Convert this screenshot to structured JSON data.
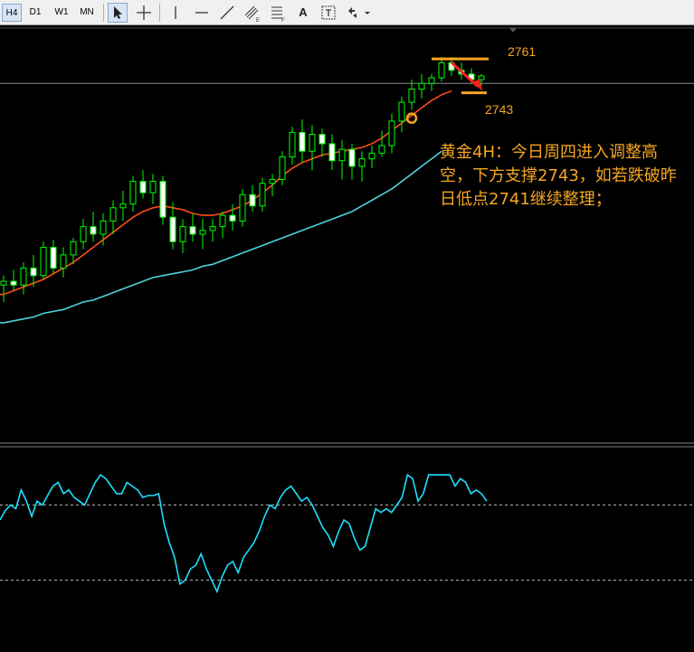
{
  "toolbar": {
    "timeframes": [
      "H4",
      "D1",
      "W1",
      "MN"
    ],
    "active_timeframe": "H4",
    "text_tool_label": "A",
    "tools": [
      "cursor-icon",
      "crosshair-icon",
      "vertical-line-icon",
      "horizontal-line-icon",
      "trendline-icon",
      "equidistant-channel-icon",
      "fibonacci-icon",
      "text-icon",
      "text-label-icon",
      "arrows-icon",
      "dropdown-caret-icon"
    ]
  },
  "annotation": {
    "text": "黄金4H：今日周四进入调整高空，下方支撑2743，如若跌破昨日低点2741继续整理；",
    "upper_price_label": "2761",
    "lower_price_label": "2743"
  },
  "colors": {
    "background": "#000000",
    "bull_candle": "#00ff00",
    "bear_candle": "#ffffff",
    "ma_fast": "#ff4d1a",
    "ma_slow": "#4fd1d9",
    "oscillator": "#1ee0ff",
    "annotation": "#f5a623",
    "arrow": "#ff2020"
  },
  "chart_data": [
    {
      "type": "candlestick",
      "title": "",
      "note": "Gold H4 candles with two moving averages; values approximated from price labels 2761 and 2743",
      "ylim": [
        2560,
        2775
      ],
      "grid": false,
      "reference_level": 2748,
      "candles": [
        {
          "o": 2641,
          "h": 2646,
          "l": 2632,
          "c": 2643
        },
        {
          "o": 2643,
          "h": 2649,
          "l": 2638,
          "c": 2641
        },
        {
          "o": 2641,
          "h": 2653,
          "l": 2636,
          "c": 2650
        },
        {
          "o": 2650,
          "h": 2657,
          "l": 2640,
          "c": 2646
        },
        {
          "o": 2646,
          "h": 2664,
          "l": 2644,
          "c": 2661
        },
        {
          "o": 2661,
          "h": 2665,
          "l": 2647,
          "c": 2650
        },
        {
          "o": 2650,
          "h": 2661,
          "l": 2645,
          "c": 2657
        },
        {
          "o": 2657,
          "h": 2666,
          "l": 2652,
          "c": 2664
        },
        {
          "o": 2664,
          "h": 2676,
          "l": 2660,
          "c": 2672
        },
        {
          "o": 2672,
          "h": 2680,
          "l": 2664,
          "c": 2668
        },
        {
          "o": 2668,
          "h": 2679,
          "l": 2662,
          "c": 2675
        },
        {
          "o": 2675,
          "h": 2686,
          "l": 2668,
          "c": 2682
        },
        {
          "o": 2682,
          "h": 2691,
          "l": 2675,
          "c": 2684
        },
        {
          "o": 2684,
          "h": 2699,
          "l": 2680,
          "c": 2696
        },
        {
          "o": 2696,
          "h": 2702,
          "l": 2687,
          "c": 2690
        },
        {
          "o": 2690,
          "h": 2700,
          "l": 2684,
          "c": 2696
        },
        {
          "o": 2696,
          "h": 2699,
          "l": 2673,
          "c": 2677
        },
        {
          "o": 2677,
          "h": 2685,
          "l": 2660,
          "c": 2664
        },
        {
          "o": 2664,
          "h": 2676,
          "l": 2658,
          "c": 2672
        },
        {
          "o": 2672,
          "h": 2679,
          "l": 2664,
          "c": 2668
        },
        {
          "o": 2668,
          "h": 2676,
          "l": 2660,
          "c": 2670
        },
        {
          "o": 2670,
          "h": 2676,
          "l": 2664,
          "c": 2672
        },
        {
          "o": 2672,
          "h": 2680,
          "l": 2666,
          "c": 2678
        },
        {
          "o": 2678,
          "h": 2684,
          "l": 2670,
          "c": 2675
        },
        {
          "o": 2675,
          "h": 2692,
          "l": 2672,
          "c": 2689
        },
        {
          "o": 2689,
          "h": 2694,
          "l": 2680,
          "c": 2683
        },
        {
          "o": 2683,
          "h": 2698,
          "l": 2680,
          "c": 2695
        },
        {
          "o": 2695,
          "h": 2700,
          "l": 2688,
          "c": 2697
        },
        {
          "o": 2697,
          "h": 2712,
          "l": 2694,
          "c": 2709
        },
        {
          "o": 2709,
          "h": 2725,
          "l": 2705,
          "c": 2722
        },
        {
          "o": 2722,
          "h": 2729,
          "l": 2706,
          "c": 2712
        },
        {
          "o": 2712,
          "h": 2726,
          "l": 2702,
          "c": 2721
        },
        {
          "o": 2721,
          "h": 2724,
          "l": 2709,
          "c": 2716
        },
        {
          "o": 2716,
          "h": 2721,
          "l": 2702,
          "c": 2707
        },
        {
          "o": 2707,
          "h": 2718,
          "l": 2697,
          "c": 2713
        },
        {
          "o": 2713,
          "h": 2716,
          "l": 2697,
          "c": 2704
        },
        {
          "o": 2704,
          "h": 2712,
          "l": 2696,
          "c": 2708
        },
        {
          "o": 2708,
          "h": 2715,
          "l": 2703,
          "c": 2711
        },
        {
          "o": 2711,
          "h": 2723,
          "l": 2709,
          "c": 2715
        },
        {
          "o": 2715,
          "h": 2732,
          "l": 2711,
          "c": 2728
        },
        {
          "o": 2728,
          "h": 2741,
          "l": 2722,
          "c": 2738
        },
        {
          "o": 2738,
          "h": 2750,
          "l": 2734,
          "c": 2745
        },
        {
          "o": 2745,
          "h": 2753,
          "l": 2740,
          "c": 2748
        },
        {
          "o": 2748,
          "h": 2753,
          "l": 2744,
          "c": 2751
        },
        {
          "o": 2751,
          "h": 2762,
          "l": 2749,
          "c": 2759
        },
        {
          "o": 2759,
          "h": 2762,
          "l": 2752,
          "c": 2755
        },
        {
          "o": 2755,
          "h": 2759,
          "l": 2750,
          "c": 2753
        },
        {
          "o": 2753,
          "h": 2756,
          "l": 2748,
          "c": 2750
        },
        {
          "o": 2750,
          "h": 2753,
          "l": 2747,
          "c": 2752
        }
      ],
      "ma_fast": [
        2636,
        2638,
        2640,
        2642,
        2644,
        2647,
        2650,
        2653,
        2657,
        2661,
        2665,
        2669,
        2673,
        2677,
        2680,
        2682,
        2683,
        2682,
        2681,
        2679,
        2678,
        2678,
        2679,
        2681,
        2683,
        2686,
        2690,
        2694,
        2699,
        2703,
        2706,
        2708,
        2710,
        2711,
        2712,
        2713,
        2714,
        2716,
        2719,
        2723,
        2727,
        2731,
        2735,
        2739,
        2742,
        2744
      ],
      "ma_slow": [
        2621,
        2622,
        2623,
        2624,
        2626,
        2627,
        2628,
        2630,
        2632,
        2633,
        2635,
        2637,
        2639,
        2641,
        2643,
        2645,
        2646,
        2647,
        2648,
        2649,
        2651,
        2652,
        2654,
        2656,
        2658,
        2660,
        2662,
        2664,
        2666,
        2668,
        2670,
        2672,
        2674,
        2676,
        2678,
        2680,
        2683,
        2686,
        2689,
        2692,
        2696,
        2700,
        2704,
        2708,
        2712
      ],
      "annotations": [
        {
          "label": "2761",
          "price": 2761
        },
        {
          "label": "2743",
          "price": 2743
        }
      ]
    },
    {
      "type": "line",
      "title": "",
      "note": "oscillator sub-window, raw indicator values not labeled",
      "ylim": [
        0,
        100
      ],
      "reference_levels": [
        70,
        30
      ],
      "series": [
        {
          "values": [
            62,
            67,
            70,
            68,
            78,
            72,
            64,
            72,
            70,
            75,
            80,
            82,
            76,
            78,
            74,
            72,
            70,
            76,
            82,
            86,
            84,
            80,
            76,
            76,
            82,
            80,
            78,
            74,
            75,
            75,
            76,
            60,
            50,
            42,
            28,
            30,
            36,
            38,
            44,
            36,
            30,
            24,
            32,
            38,
            40,
            34,
            42,
            46,
            50,
            56,
            64,
            70,
            68,
            74,
            78,
            80,
            76,
            72,
            74,
            70,
            64,
            58,
            54,
            48,
            56,
            62,
            60,
            52,
            46,
            48,
            58,
            68,
            66,
            68,
            66,
            70,
            74,
            86,
            84,
            72,
            76,
            86,
            86,
            86,
            86,
            86,
            80,
            84,
            82,
            76,
            78,
            76,
            72
          ]
        }
      ]
    }
  ]
}
